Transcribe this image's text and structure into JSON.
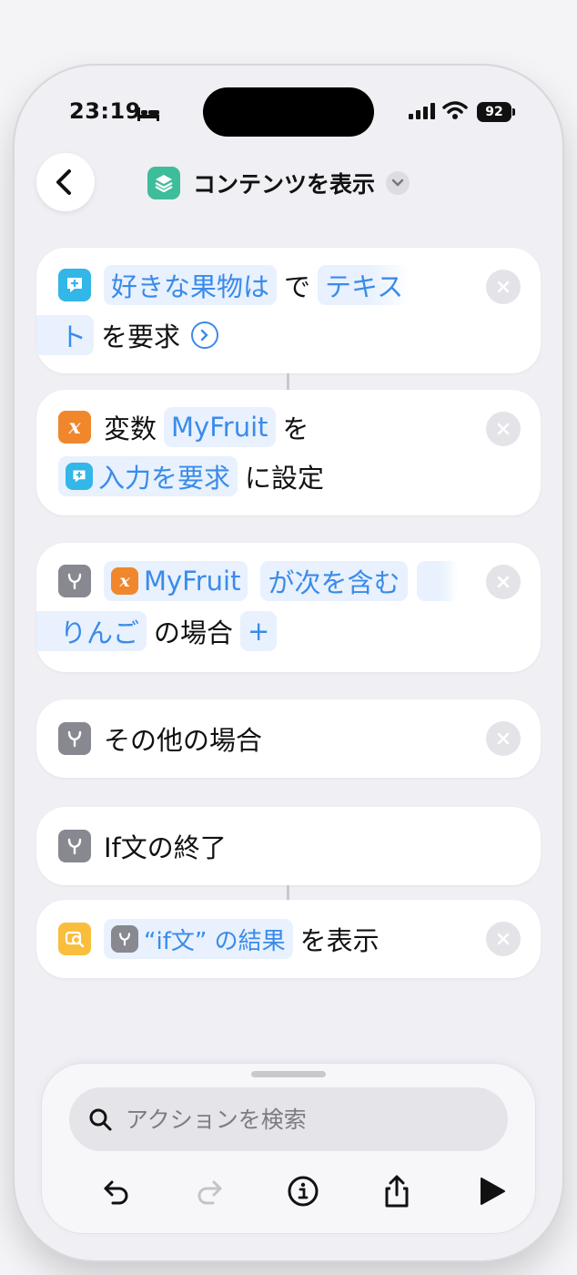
{
  "status_bar": {
    "time": "23:19",
    "battery": "92"
  },
  "header": {
    "title": "コンテンツを表示"
  },
  "actions": [
    {
      "line1": {
        "token1": "好きな果物は",
        "text1": "で",
        "token2": "テキス"
      },
      "line2": {
        "token1": "ト",
        "text1": "を要求"
      }
    },
    {
      "line1": {
        "text1": "変数",
        "token1": "MyFruit",
        "text2": "を"
      },
      "line2": {
        "token1": "入力を要求",
        "text1": "に設定"
      }
    },
    {
      "line1": {
        "token1": "MyFruit",
        "token2": "が次を含む"
      },
      "line2": {
        "token1": "りんご",
        "text1": "の場合",
        "add": "+"
      }
    },
    {
      "line1": {
        "text1": "その他の場合"
      }
    },
    {
      "line1": {
        "text1": "If文の終了"
      }
    },
    {
      "line1": {
        "token1": "“if文” の結果",
        "text1": "を表示"
      }
    }
  ],
  "panel": {
    "search_placeholder": "アクションを検索"
  },
  "colors": {
    "accent": "#3a8bea",
    "token_bg": "#e8f1fd",
    "variable_icon": "#f0872c",
    "ask_icon": "#33b6e8",
    "if_icon": "#888891",
    "show_icon": "#f8be3c",
    "shortcut_icon": "#3dbd99"
  }
}
